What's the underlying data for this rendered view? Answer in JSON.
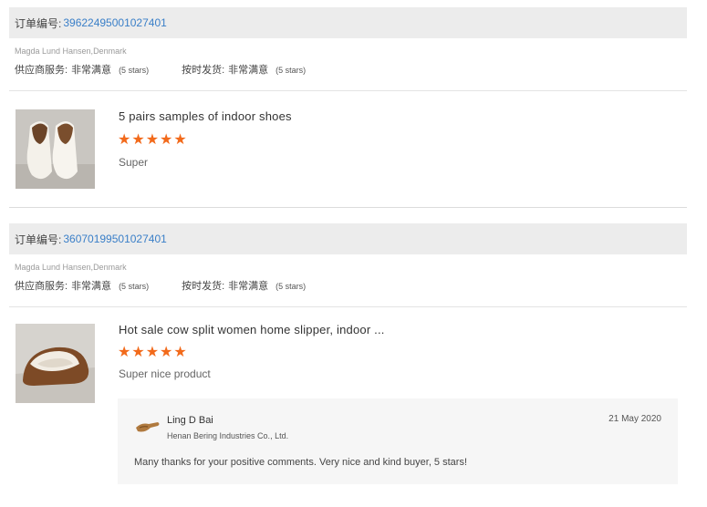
{
  "orders": [
    {
      "order_label": "订单编号:",
      "order_number": "39622495001027401",
      "buyer": "Magda Lund Hansen,Denmark",
      "supplier_service_label": "供应商服务:",
      "supplier_service_value": "非常满意",
      "supplier_service_stars": "(5 stars)",
      "on_time_label": "按时发货:",
      "on_time_value": "非常满意",
      "on_time_stars": "(5 stars)",
      "product_title": "5 pairs samples of indoor shoes",
      "product_image_icon": "fur-slippers-pair-icon",
      "rating": "5",
      "stars": "★★★★★",
      "comment": "Super"
    },
    {
      "order_label": "订单编号:",
      "order_number": "36070199501027401",
      "buyer": "Magda Lund Hansen,Denmark",
      "supplier_service_label": "供应商服务:",
      "supplier_service_value": "非常满意",
      "supplier_service_stars": "(5 stars)",
      "on_time_label": "按时发货:",
      "on_time_value": "非常满意",
      "on_time_stars": "(5 stars)",
      "product_title": "Hot sale cow split women home slipper, indoor ...",
      "product_image_icon": "cow-split-slipper-icon",
      "rating": "5",
      "stars": "★★★★★",
      "comment": "Super nice product",
      "reply": {
        "name": "Ling D Bai",
        "company": "Henan Bering Industries Co., Ltd.",
        "date": "21 May 2020",
        "message": "Many thanks for your positive comments. Very nice and kind buyer, 5 stars!",
        "logo_icon": "company-logo-icon"
      }
    }
  ],
  "colors": {
    "accent_link": "#3a7fc8",
    "star": "#f26a1b",
    "header_bg": "#ececec",
    "reply_bg": "#f6f6f6"
  }
}
